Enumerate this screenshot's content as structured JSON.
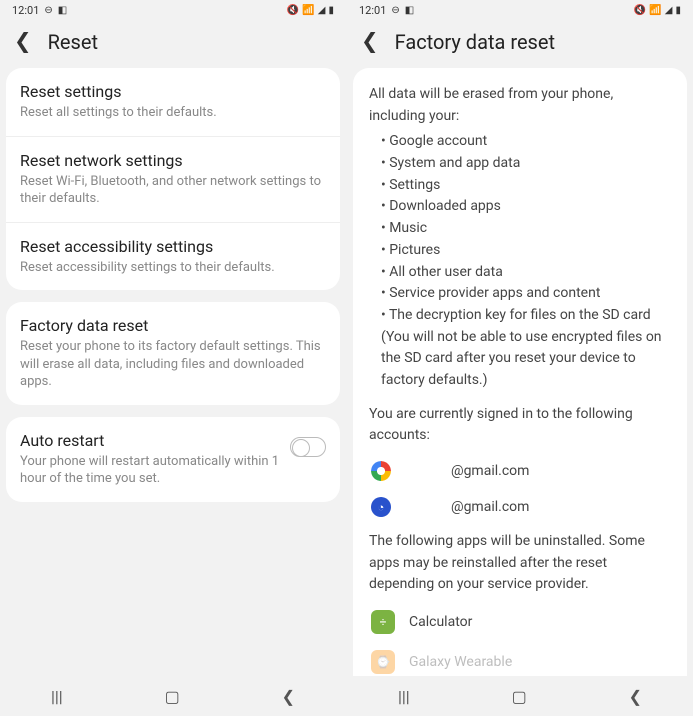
{
  "status": {
    "time": "12:01"
  },
  "left": {
    "title": "Reset",
    "section1": [
      {
        "title": "Reset settings",
        "subtitle": "Reset all settings to their defaults."
      },
      {
        "title": "Reset network settings",
        "subtitle": "Reset Wi-Fi, Bluetooth, and other network settings to their defaults."
      },
      {
        "title": "Reset accessibility settings",
        "subtitle": "Reset accessibility settings to their defaults."
      }
    ],
    "section2": [
      {
        "title": "Factory data reset",
        "subtitle": "Reset your phone to its factory default settings. This will erase all data, including files and downloaded apps."
      }
    ],
    "section3": {
      "title": "Auto restart",
      "subtitle": "Your phone will restart automatically within 1 hour of the time you set."
    }
  },
  "right": {
    "title": "Factory data reset",
    "intro": "All data will be erased from your phone, including your:",
    "bullets": [
      "Google account",
      "System and app data",
      "Settings",
      "Downloaded apps",
      "Music",
      "Pictures",
      "All other user data",
      "Service provider apps and content",
      "The decryption key for files on the SD card (You will not be able to use encrypted files on the SD card after you reset your device to factory defaults.)"
    ],
    "accounts_intro": "You are currently signed in to the following accounts:",
    "accounts": [
      {
        "type": "google",
        "email": "@gmail.com"
      },
      {
        "type": "samsung",
        "email": "@gmail.com"
      }
    ],
    "apps_intro": "The following apps will be uninstalled. Some apps may be reinstalled after the reset depending on your service provider.",
    "apps": [
      {
        "name": "Calculator",
        "icon": "calc"
      },
      {
        "name": "Galaxy Wearable",
        "icon": "wear"
      }
    ]
  }
}
